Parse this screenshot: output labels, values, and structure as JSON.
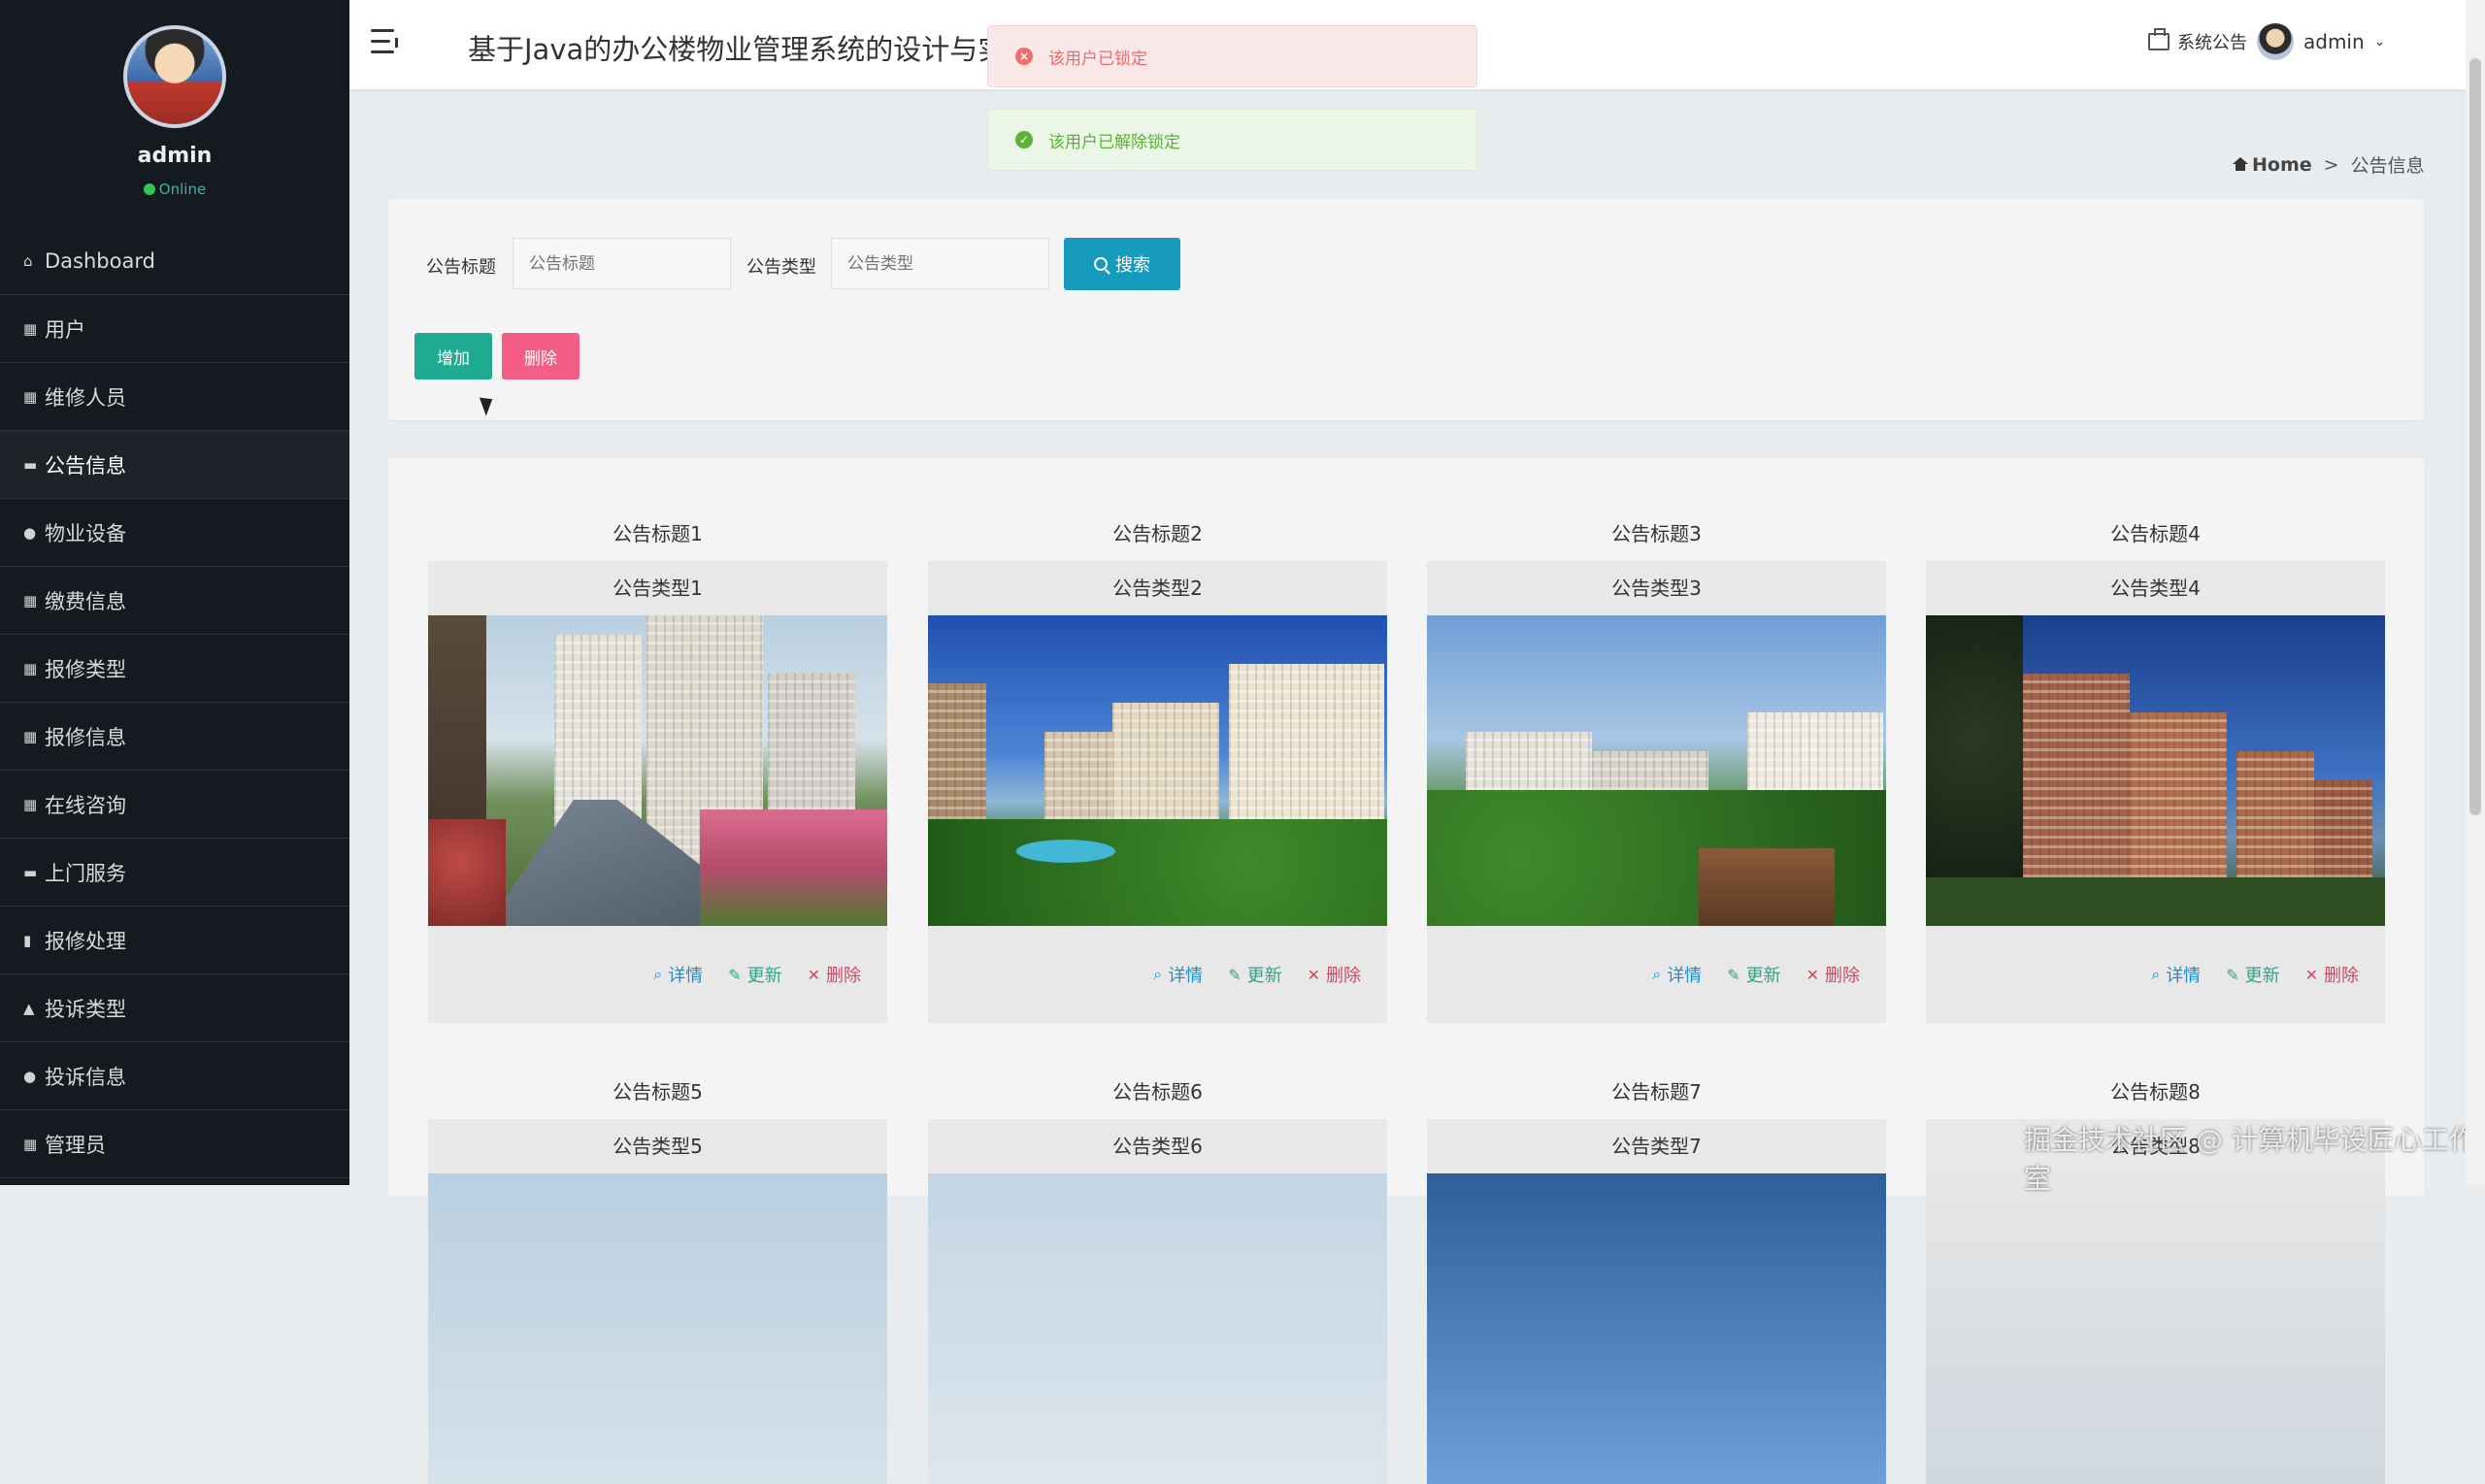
{
  "sidebar": {
    "user_name": "admin",
    "status": "Online",
    "items": [
      {
        "label": "Dashboard",
        "icon": "home-icon"
      },
      {
        "label": "用户",
        "icon": "grid-icon"
      },
      {
        "label": "维修人员",
        "icon": "grid-icon"
      },
      {
        "label": "公告信息",
        "icon": "notice-icon"
      },
      {
        "label": "物业设备",
        "icon": "user-icon"
      },
      {
        "label": "缴费信息",
        "icon": "grid-icon"
      },
      {
        "label": "报修类型",
        "icon": "grid-icon"
      },
      {
        "label": "报修信息",
        "icon": "table-icon"
      },
      {
        "label": "在线咨询",
        "icon": "grid-icon"
      },
      {
        "label": "上门服务",
        "icon": "briefcase-icon"
      },
      {
        "label": "报修处理",
        "icon": "bar-chart-icon"
      },
      {
        "label": "投诉类型",
        "icon": "thumbs-icon"
      },
      {
        "label": "投诉信息",
        "icon": "user-icon"
      },
      {
        "label": "管理员",
        "icon": "grid-icon"
      }
    ],
    "active_index": 3
  },
  "header": {
    "title": "基于Java的办公楼物业管理系统的设计与实",
    "notice_label": "系统公告",
    "user_label": "admin"
  },
  "toasts": {
    "error": "该用户已锁定",
    "success": "该用户已解除锁定"
  },
  "breadcrumb": {
    "home": "Home",
    "separator": ">",
    "current": "公告信息"
  },
  "search": {
    "title_label": "公告标题",
    "title_placeholder": "公告标题",
    "type_label": "公告类型",
    "type_placeholder": "公告类型",
    "search_button": "搜索",
    "add_button": "增加",
    "delete_button": "删除"
  },
  "cards": [
    {
      "title": "公告标题1",
      "type": "公告类型1"
    },
    {
      "title": "公告标题2",
      "type": "公告类型2"
    },
    {
      "title": "公告标题3",
      "type": "公告类型3"
    },
    {
      "title": "公告标题4",
      "type": "公告类型4"
    },
    {
      "title": "公告标题5",
      "type": "公告类型5"
    },
    {
      "title": "公告标题6",
      "type": "公告类型6"
    },
    {
      "title": "公告标题7",
      "type": "公告类型7"
    },
    {
      "title": "公告标题8",
      "type": "公告类型8"
    }
  ],
  "card_actions": {
    "detail": "详情",
    "update": "更新",
    "delete": "删除"
  },
  "watermark": "掘金技术社区 @ 计算机毕设匠心工作室",
  "colors": {
    "sidebar_bg": "#141a1f",
    "search_button": "#169bbd",
    "add_button": "#1faa92",
    "delete_button": "#f45d85",
    "error_toast": "#fbe9e9",
    "success_toast": "#ecf6e6"
  }
}
